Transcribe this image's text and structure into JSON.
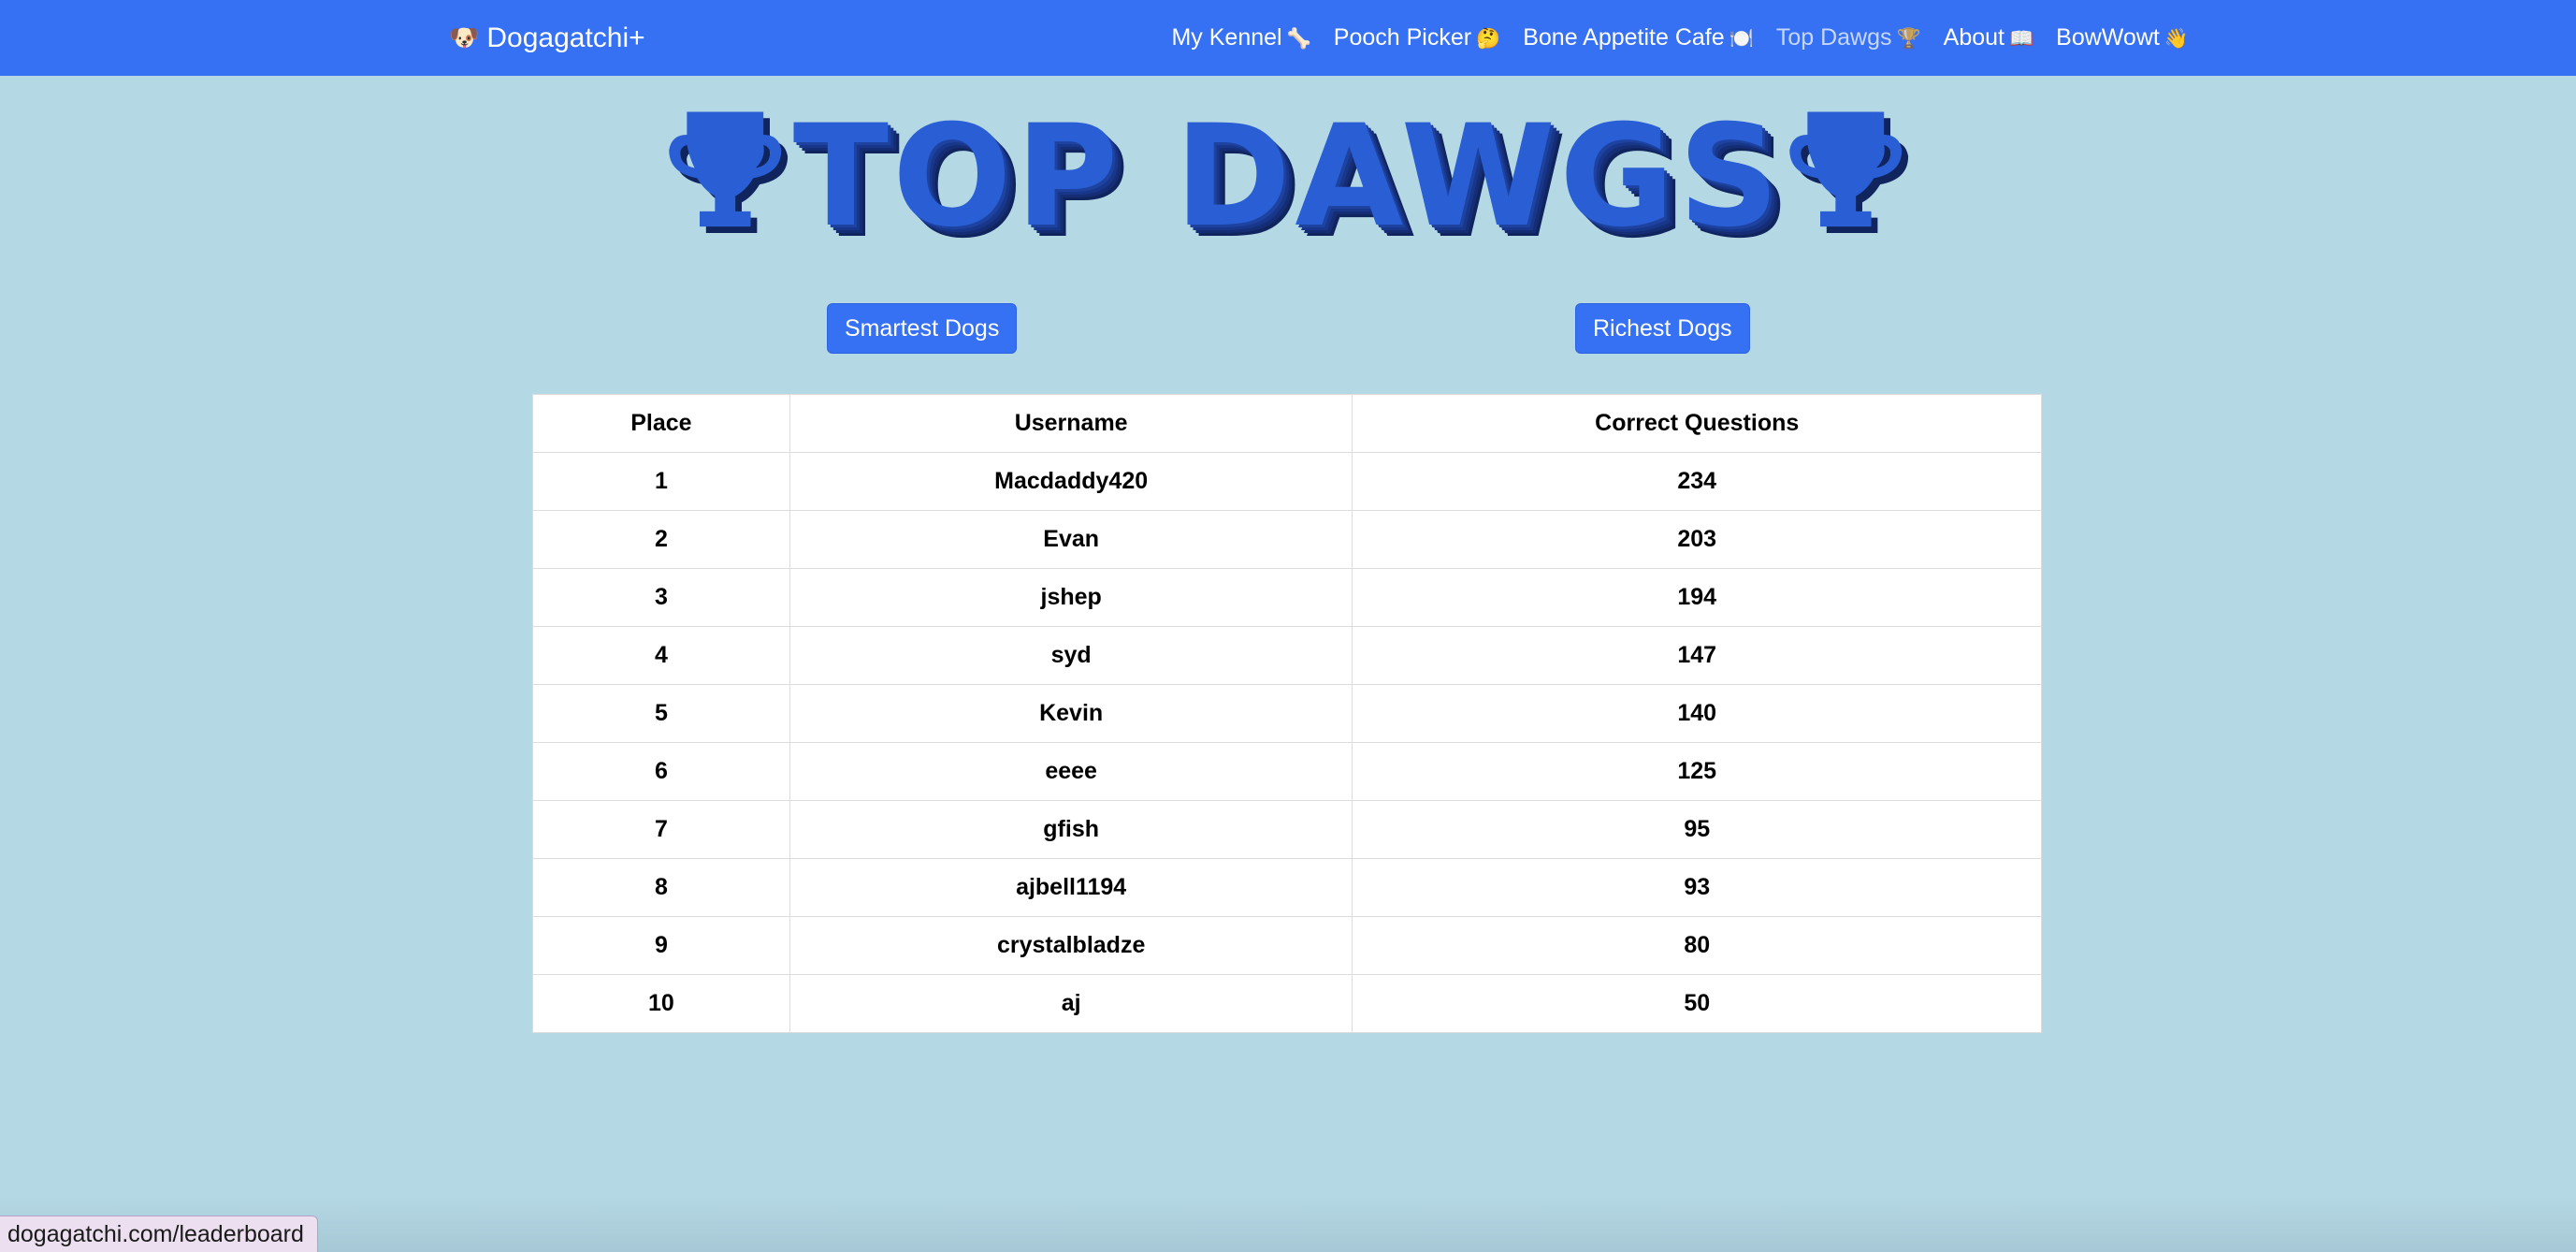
{
  "navbar": {
    "brand_emoji": "🐶",
    "brand_label": "Dogagatchi+",
    "links": [
      {
        "label": "My Kennel",
        "emoji": "🦴"
      },
      {
        "label": "Pooch Picker",
        "emoji": "🤔"
      },
      {
        "label": "Bone Appetite Cafe",
        "emoji": "🍽️"
      },
      {
        "label": "Top Dawgs",
        "emoji": "🏆"
      },
      {
        "label": "About",
        "emoji": "📖"
      },
      {
        "label": "BowWowt",
        "emoji": "👋"
      }
    ],
    "active_link": "Top Dawgs"
  },
  "hero": {
    "title": "TOP DAWGS",
    "icon": "trophy-icon",
    "color": "#2a5ed4"
  },
  "tabs": {
    "smartest_label": "Smartest Dogs",
    "richest_label": "Richest Dogs"
  },
  "leaderboard": {
    "headers": [
      "Place",
      "Username",
      "Correct Questions"
    ],
    "rows": [
      {
        "place": "1",
        "username": "Macdaddy420",
        "correct": "234"
      },
      {
        "place": "2",
        "username": "Evan",
        "correct": "203"
      },
      {
        "place": "3",
        "username": "jshep",
        "correct": "194"
      },
      {
        "place": "4",
        "username": "syd",
        "correct": "147"
      },
      {
        "place": "5",
        "username": "Kevin",
        "correct": "140"
      },
      {
        "place": "6",
        "username": "eeee",
        "correct": "125"
      },
      {
        "place": "7",
        "username": "gfish",
        "correct": "95"
      },
      {
        "place": "8",
        "username": "ajbell1194",
        "correct": "93"
      },
      {
        "place": "9",
        "username": "crystalbladze",
        "correct": "80"
      },
      {
        "place": "10",
        "username": "aj",
        "correct": "50"
      }
    ]
  },
  "status_bar": {
    "url": "dogagatchi.com/leaderboard"
  },
  "colors": {
    "navbar": "#3670f3",
    "background": "#b5d8e5",
    "button": "#3670f3"
  }
}
